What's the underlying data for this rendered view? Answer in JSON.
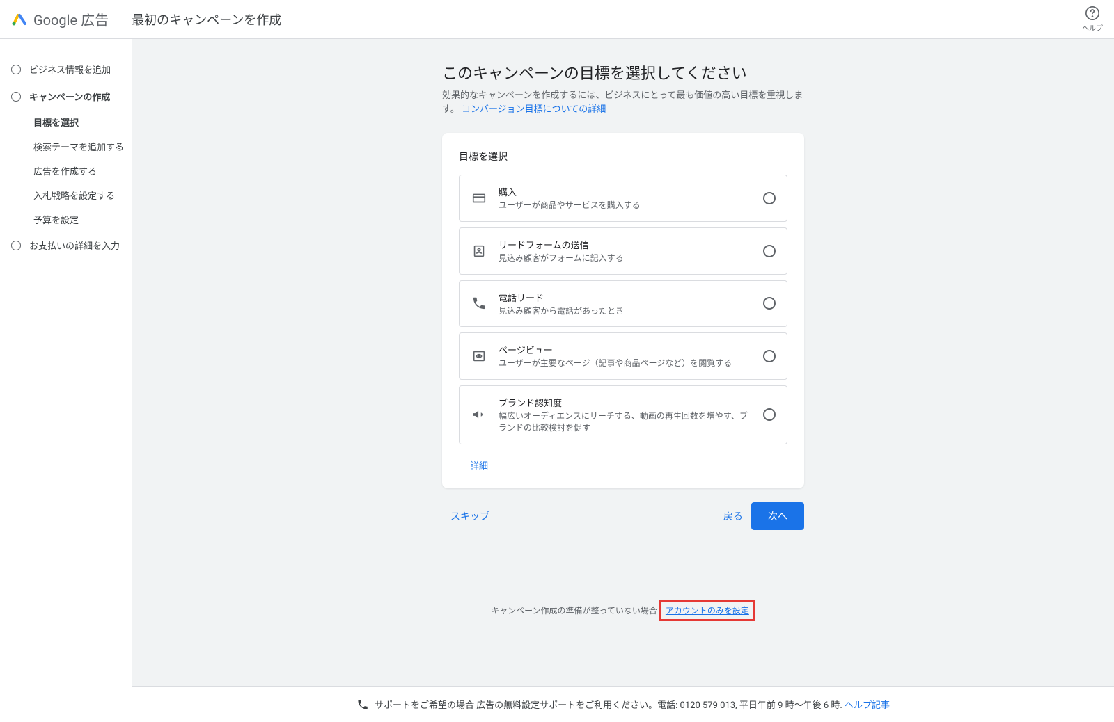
{
  "header": {
    "product": "Google 広告",
    "title": "最初のキャンペーンを作成",
    "help": "ヘルプ"
  },
  "sidebar": {
    "steps": [
      {
        "label": "ビジネス情報を追加"
      },
      {
        "label": "キャンペーンの作成",
        "active": true
      },
      {
        "label": "お支払いの詳細を入力"
      }
    ],
    "subSteps": [
      {
        "label": "目標を選択",
        "active": true
      },
      {
        "label": "検索テーマを追加する"
      },
      {
        "label": "広告を作成する"
      },
      {
        "label": "入札戦略を設定する"
      },
      {
        "label": "予算を設定"
      }
    ]
  },
  "main": {
    "title": "このキャンペーンの目標を選択してください",
    "desc": "効果的なキャンペーンを作成するには、ビジネスにとって最も価値の高い目標を重視します。",
    "descLink": "コンバージョン目標についての詳細",
    "cardTitle": "目標を選択",
    "goals": [
      {
        "name": "購入",
        "desc": "ユーザーが商品やサービスを購入する"
      },
      {
        "name": "リードフォームの送信",
        "desc": "見込み顧客がフォームに記入する"
      },
      {
        "name": "電話リード",
        "desc": "見込み顧客から電話があったとき"
      },
      {
        "name": "ページビュー",
        "desc": "ユーザーが主要なページ（記事や商品ページなど）を閲覧する"
      },
      {
        "name": "ブランド認知度",
        "desc": "幅広いオーディエンスにリーチする、動画の再生回数を増やす、ブランドの比較検討を促す"
      }
    ],
    "detailsLink": "詳細",
    "skip": "スキップ",
    "back": "戻る",
    "next": "次へ",
    "accountPrefix": "キャンペーン作成の準備が整っていない場合 ",
    "accountLink": "アカウントのみを設定"
  },
  "footer": {
    "text": "サポートをご希望の場合 広告の無料設定サポートをご利用ください。電話: 0120 579 013, 平日午前 9 時～午後 6 時. ",
    "link": "ヘルプ記事"
  }
}
